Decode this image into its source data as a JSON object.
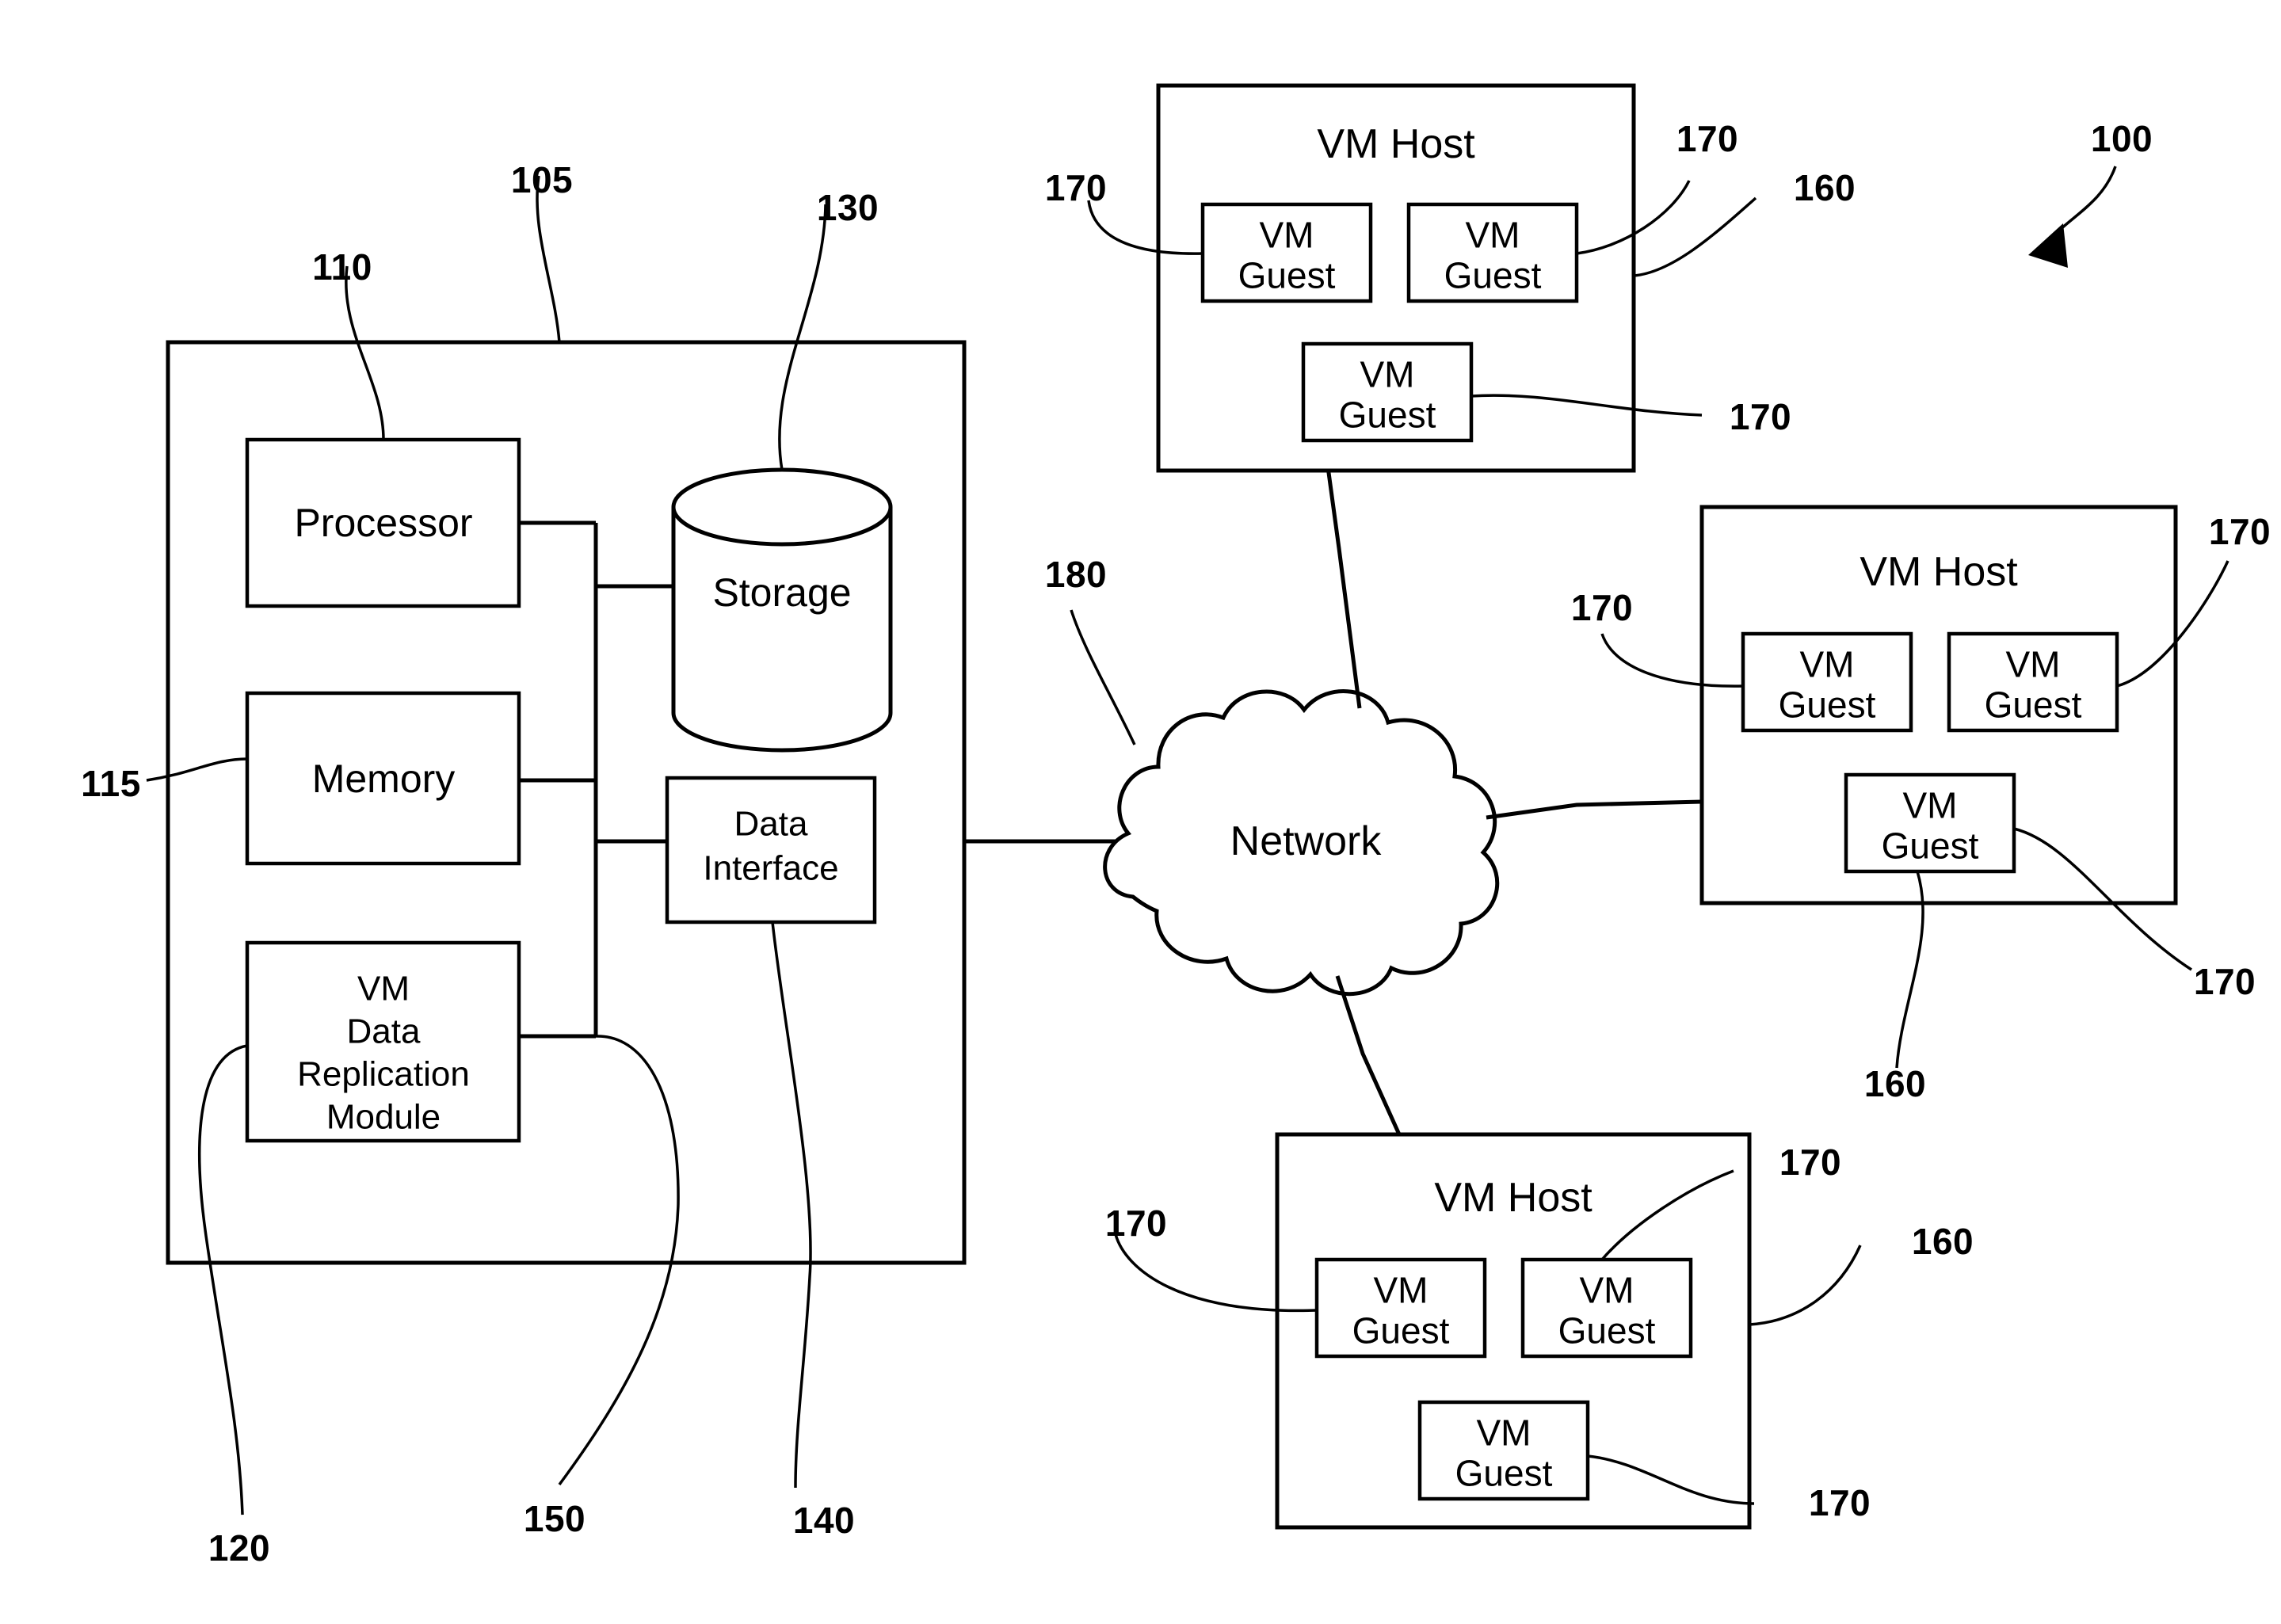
{
  "figure": {
    "system_ref": "100",
    "device": {
      "ref": "105",
      "label_ref_processor": "110",
      "label_ref_memory": "115",
      "label_ref_storage": "130",
      "label_ref_module": "120",
      "label_ref_bus": "150",
      "label_ref_data_interface": "140",
      "components": {
        "processor": "Processor",
        "memory": "Memory",
        "storage": "Storage",
        "data_interface_line1": "Data",
        "data_interface_line2": "Interface",
        "module_line1": "VM",
        "module_line2": "Data",
        "module_line3": "Replication",
        "module_line4": "Module"
      }
    },
    "network": {
      "label": "Network",
      "ref": "180"
    },
    "vm_hosts": [
      {
        "id": "vm-host-top",
        "title": "VM Host",
        "host_ref": "160",
        "guests": [
          {
            "line1": "VM",
            "line2": "Guest",
            "ref": "170"
          },
          {
            "line1": "VM",
            "line2": "Guest",
            "ref": "170"
          },
          {
            "line1": "VM",
            "line2": "Guest",
            "ref": "170"
          }
        ]
      },
      {
        "id": "vm-host-right",
        "title": "VM Host",
        "host_ref": "160",
        "guests": [
          {
            "line1": "VM",
            "line2": "Guest",
            "ref": "170"
          },
          {
            "line1": "VM",
            "line2": "Guest",
            "ref": "170"
          },
          {
            "line1": "VM",
            "line2": "Guest",
            "ref": "170"
          }
        ]
      },
      {
        "id": "vm-host-bottom",
        "title": "VM Host",
        "host_ref": "160",
        "guests": [
          {
            "line1": "VM",
            "line2": "Guest",
            "ref": "170"
          },
          {
            "line1": "VM",
            "line2": "Guest",
            "ref": "170"
          },
          {
            "line1": "VM",
            "line2": "Guest",
            "ref": "170"
          }
        ]
      }
    ],
    "reference_numerals": {
      "system": "100",
      "device": "105",
      "processor": "110",
      "memory": "115",
      "module": "120",
      "storage": "130",
      "data_interface": "140",
      "bus": "150",
      "vm_host": "160",
      "vm_guest": "170",
      "network": "180"
    },
    "colors": {
      "ink": "#000000",
      "paper": "#ffffff"
    }
  }
}
